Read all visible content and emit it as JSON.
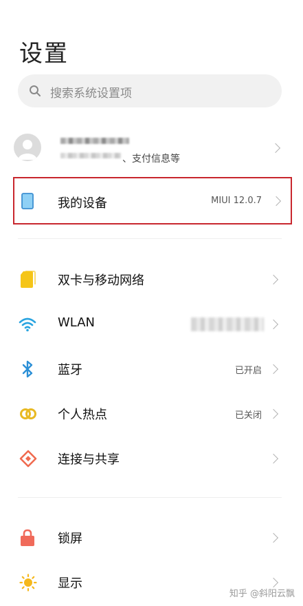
{
  "page": {
    "title": "设置"
  },
  "search": {
    "placeholder": "搜索系统设置项"
  },
  "account": {
    "subtitle_visible": "、支付信息等"
  },
  "device": {
    "label": "我的设备",
    "value": "MIUI 12.0.7"
  },
  "rows": [
    {
      "label": "双卡与移动网络",
      "value": "",
      "icon": "sim-card-icon"
    },
    {
      "label": "WLAN",
      "value": "",
      "icon": "wifi-icon"
    },
    {
      "label": "蓝牙",
      "value": "已开启",
      "icon": "bluetooth-icon"
    },
    {
      "label": "个人热点",
      "value": "已关闭",
      "icon": "hotspot-icon"
    },
    {
      "label": "连接与共享",
      "value": "",
      "icon": "connection-share-icon"
    },
    {
      "label": "锁屏",
      "value": "",
      "icon": "lock-icon"
    },
    {
      "label": "显示",
      "value": "",
      "icon": "brightness-icon"
    }
  ],
  "watermark": "知乎 @斜阳云飘",
  "colors": {
    "highlight_border": "#c8262d",
    "sim": "#f5c518",
    "wifi": "#2aa4e0",
    "bluetooth": "#2b8fd6",
    "hotspot": "#e8b923",
    "connection": "#f06a4f",
    "lock": "#f06a5a",
    "brightness": "#f5b81c"
  }
}
